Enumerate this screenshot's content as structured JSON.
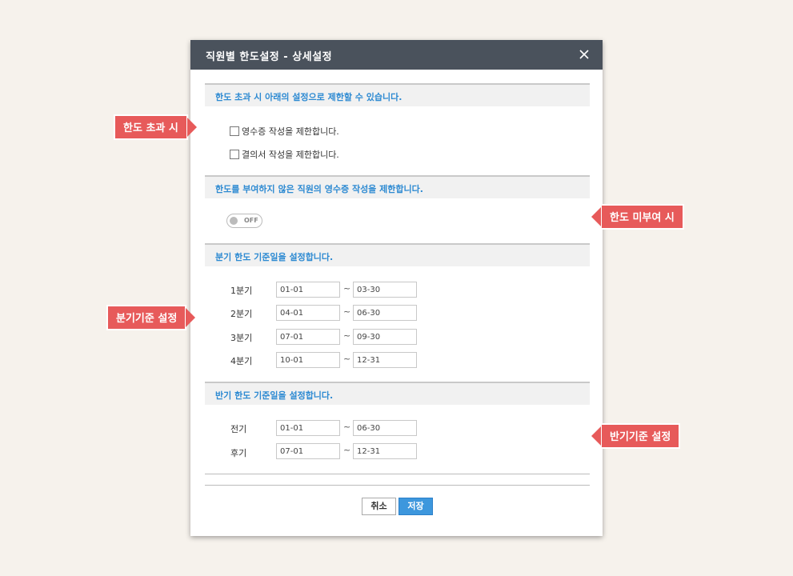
{
  "dialog": {
    "title": "직원별 한도설정 - 상세설정",
    "close_icon": "close-icon"
  },
  "sections": {
    "over_limit": {
      "heading": "한도 초과 시 아래의 설정으로 제한할 수 있습니다.",
      "options": [
        "영수증 작성을 제한합니다.",
        "결의서 작성을 제한합니다."
      ]
    },
    "no_limit": {
      "heading": "한도를 부여하지 않은 직원의 영수증 작성을 제한합니다.",
      "toggle_label": "OFF"
    },
    "quarter": {
      "heading": "분기 한도 기준일을 설정합니다.",
      "rows": [
        {
          "label": "1분기",
          "start": "01-01",
          "end": "03-30"
        },
        {
          "label": "2분기",
          "start": "04-01",
          "end": "06-30"
        },
        {
          "label": "3분기",
          "start": "07-01",
          "end": "09-30"
        },
        {
          "label": "4분기",
          "start": "10-01",
          "end": "12-31"
        }
      ]
    },
    "half": {
      "heading": "반기 한도 기준일을 설정합니다.",
      "rows": [
        {
          "label": "전기",
          "start": "01-01",
          "end": "06-30"
        },
        {
          "label": "후기",
          "start": "07-01",
          "end": "12-31"
        }
      ]
    }
  },
  "separator": "~",
  "buttons": {
    "cancel": "취소",
    "save": "저장"
  },
  "callouts": {
    "over_limit": "한도 초과 시",
    "no_limit": "한도 미부여 시",
    "quarter": "분기기준 설정",
    "half": "반기기준 설정"
  },
  "colors": {
    "accent": "#2d8ad2",
    "callout": "#e75a5a",
    "titlebar": "#4a525c",
    "save_button": "#3d97dd"
  }
}
